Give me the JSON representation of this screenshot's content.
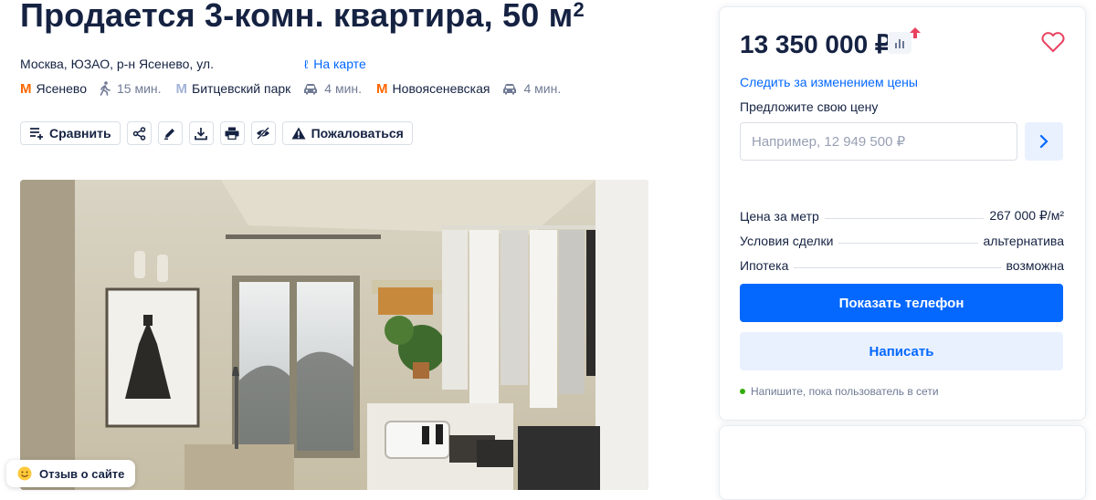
{
  "listing": {
    "title": "Продается 3-комн. квартира, 50 м",
    "title_sup": "2",
    "address": "Москва, ЮЗАО, р-н Ясенево, ул.",
    "map_link": "На карте",
    "metros": [
      {
        "symbol": "М",
        "color": "#ff6600",
        "name": "Ясенево",
        "mode": "walk",
        "time": "15 мин."
      },
      {
        "symbol": "М",
        "color": "#a3b3d9",
        "name": "Битцевский парк",
        "mode": "car",
        "time": "4 мин."
      },
      {
        "symbol": "М",
        "color": "#ff6600",
        "name": "Новоясеневская",
        "mode": "car",
        "time": "4 мин."
      }
    ]
  },
  "toolbar": {
    "compare": "Сравнить",
    "report": "Пожаловаться",
    "icons": [
      "compare-icon",
      "share-icon",
      "edit-icon",
      "download-icon",
      "print-icon",
      "hide-icon",
      "warning-icon"
    ]
  },
  "feedback": {
    "label": "Отзыв о сайте"
  },
  "sidebar": {
    "price": "13 350 000 ₽",
    "track_price": "Следить за изменением цены",
    "offer_label": "Предложите свою цену",
    "offer_placeholder": "Например, 12 949 500 ₽",
    "specs": [
      {
        "key": "Цена за метр",
        "value": "267 000 ₽/м²"
      },
      {
        "key": "Условия сделки",
        "value": "альтернатива"
      },
      {
        "key": "Ипотека",
        "value": "возможна"
      }
    ],
    "show_phone": "Показать телефон",
    "write": "Написать",
    "online_hint": "Напишите, пока пользователь в сети"
  },
  "colors": {
    "accent": "#0468ff",
    "accent_light": "#e9f1ff",
    "text": "#152242",
    "muted": "#707a95",
    "online": "#34ac0a",
    "price_up": "#e84260"
  }
}
